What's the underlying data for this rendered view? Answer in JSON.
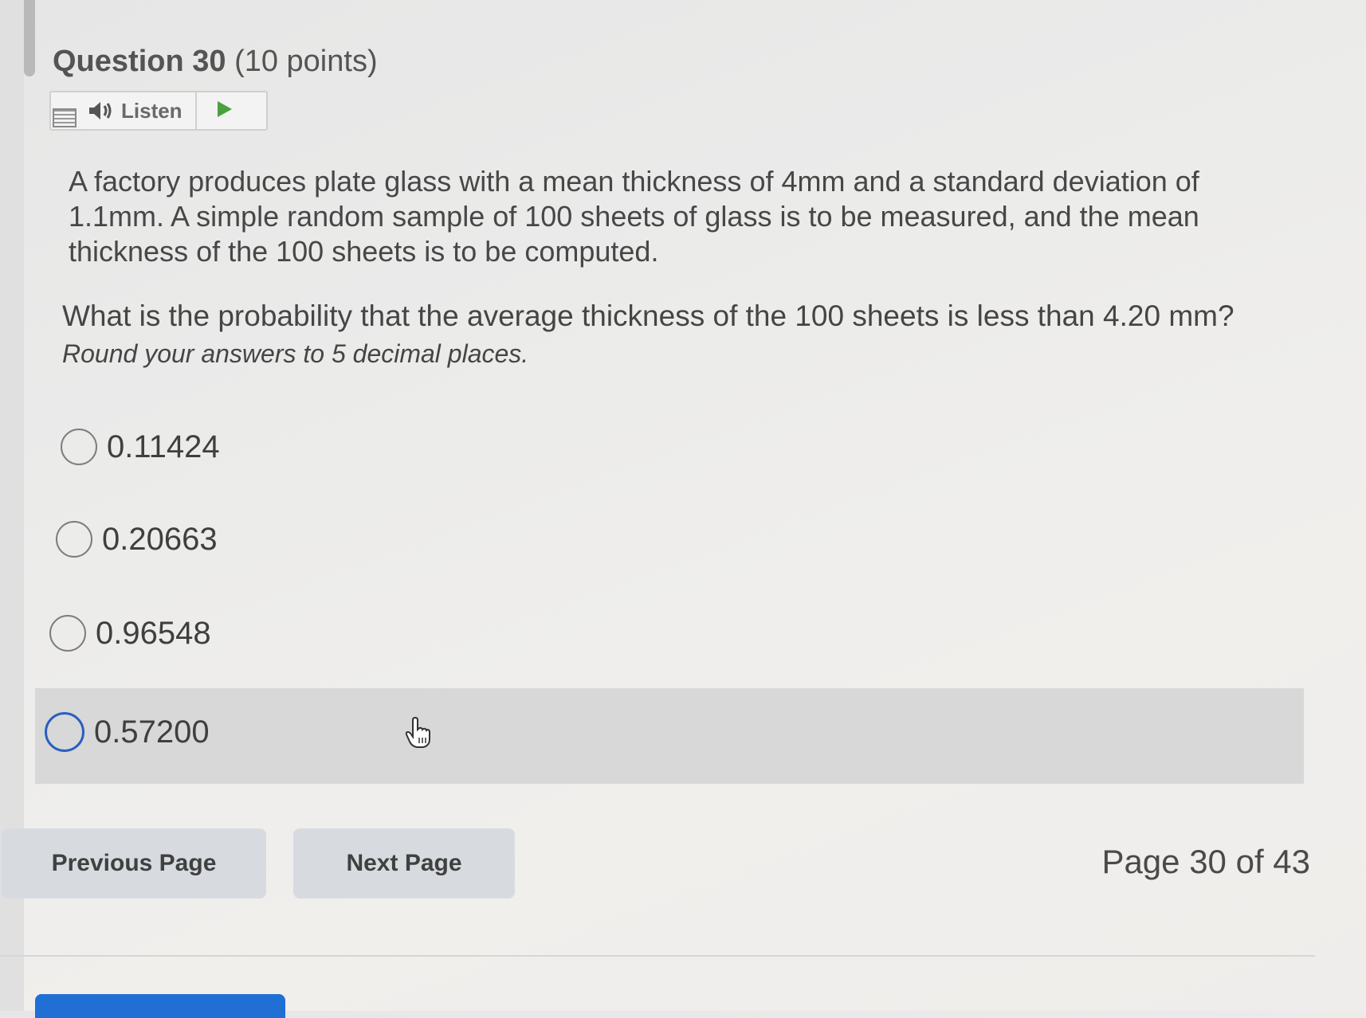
{
  "question": {
    "number_label": "Question 30",
    "points_label": "(10 points)",
    "body": "A factory produces plate glass with a mean thickness of 4mm and a standard deviation of 1.1mm. A simple random sample of 100 sheets of glass is to be measured, and the mean thickness of the 100 sheets is to be computed.",
    "prompt": "What is the probability that the average thickness of the 100 sheets is less than 4.20 mm?",
    "hint": "Round your answers to 5 decimal places."
  },
  "listen": {
    "label": "Listen",
    "icons": [
      "document-icon",
      "speaker-icon",
      "play-icon"
    ]
  },
  "options": [
    {
      "label": "0.11424"
    },
    {
      "label": "0.20663"
    },
    {
      "label": "0.96548"
    },
    {
      "label": "0.57200"
    }
  ],
  "navigation": {
    "previous_label": "Previous Page",
    "next_label": "Next Page",
    "page_indicator": "Page 30 of 43"
  },
  "colors": {
    "focus_ring": "#2a5fc0",
    "play_icon": "#4aa03f",
    "submit_button": "#1f6fd4"
  }
}
